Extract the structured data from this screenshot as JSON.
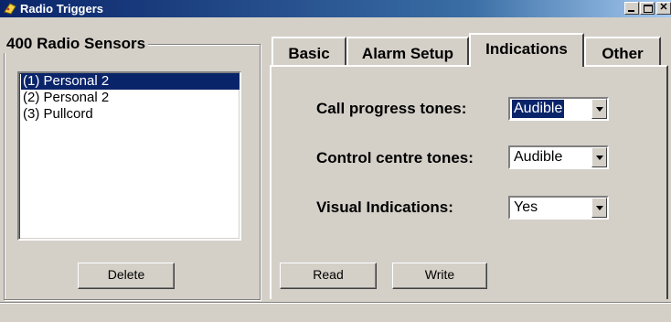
{
  "window": {
    "title": "Radio Triggers"
  },
  "sensors": {
    "group_title": "400 Radio Sensors",
    "items": [
      {
        "label": "(1) Personal 2",
        "selected": true
      },
      {
        "label": "(2) Personal 2",
        "selected": false
      },
      {
        "label": "(3) Pullcord",
        "selected": false
      }
    ],
    "delete_label": "Delete"
  },
  "tabs": [
    {
      "label": "Basic",
      "active": false
    },
    {
      "label": "Alarm Setup",
      "active": false
    },
    {
      "label": "Indications",
      "active": true
    },
    {
      "label": "Other",
      "active": false
    }
  ],
  "indications": {
    "call_progress": {
      "label": "Call progress tones:",
      "value": "Audible"
    },
    "control_centre": {
      "label": "Control centre tones:",
      "value": "Audible"
    },
    "visual": {
      "label": "Visual Indications:",
      "value": "Yes"
    }
  },
  "actions": {
    "read_label": "Read",
    "write_label": "Write"
  },
  "colors": {
    "title_bar": "#0a246a",
    "selection": "#0a246a",
    "face": "#d4d0c8"
  },
  "icons": {
    "app": "radio-trigger-app-icon"
  }
}
